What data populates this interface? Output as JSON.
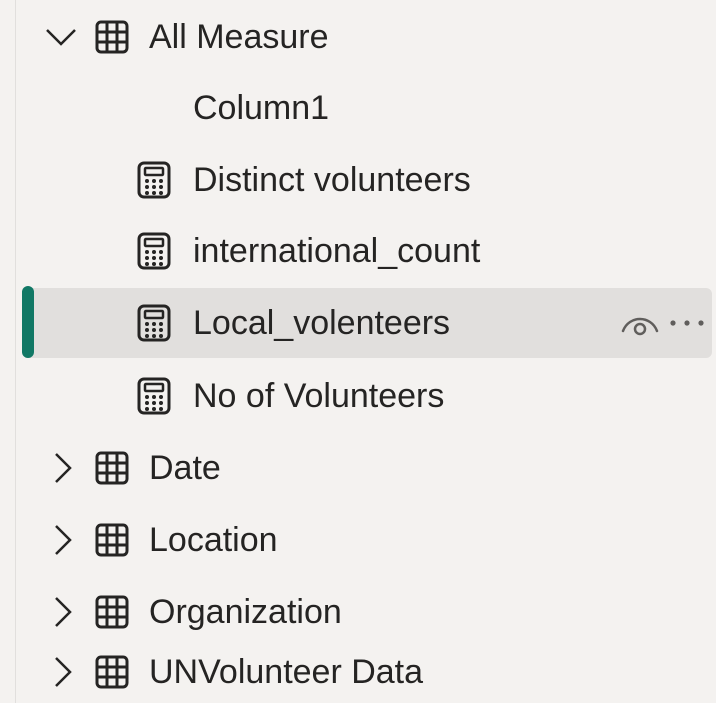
{
  "tree": {
    "items": [
      {
        "label": "All Measure",
        "kind": "table",
        "expanded": true,
        "icon": "table-icon"
      },
      {
        "label": "Column1",
        "kind": "column"
      },
      {
        "label": "Distinct volunteers",
        "kind": "measure",
        "icon": "calculator-icon"
      },
      {
        "label": "international_count",
        "kind": "measure",
        "icon": "calculator-icon"
      },
      {
        "label": "Local_volenteers",
        "kind": "measure",
        "icon": "calculator-icon",
        "selected": true
      },
      {
        "label": "No of Volunteers",
        "kind": "measure",
        "icon": "calculator-icon"
      },
      {
        "label": "Date",
        "kind": "table",
        "expanded": false,
        "icon": "table-icon"
      },
      {
        "label": "Location",
        "kind": "table",
        "expanded": false,
        "icon": "table-icon"
      },
      {
        "label": "Organization",
        "kind": "table",
        "expanded": false,
        "icon": "table-icon"
      },
      {
        "label": "UNVolunteer Data",
        "kind": "table",
        "expanded": false,
        "icon": "table-icon"
      }
    ],
    "selected_row_actions": [
      "eye-icon",
      "more-options-icon"
    ]
  },
  "colors": {
    "background": "#f4f2f0",
    "selected_background": "#e1dfdd",
    "selection_accent": "#117865",
    "text": "#252423"
  }
}
